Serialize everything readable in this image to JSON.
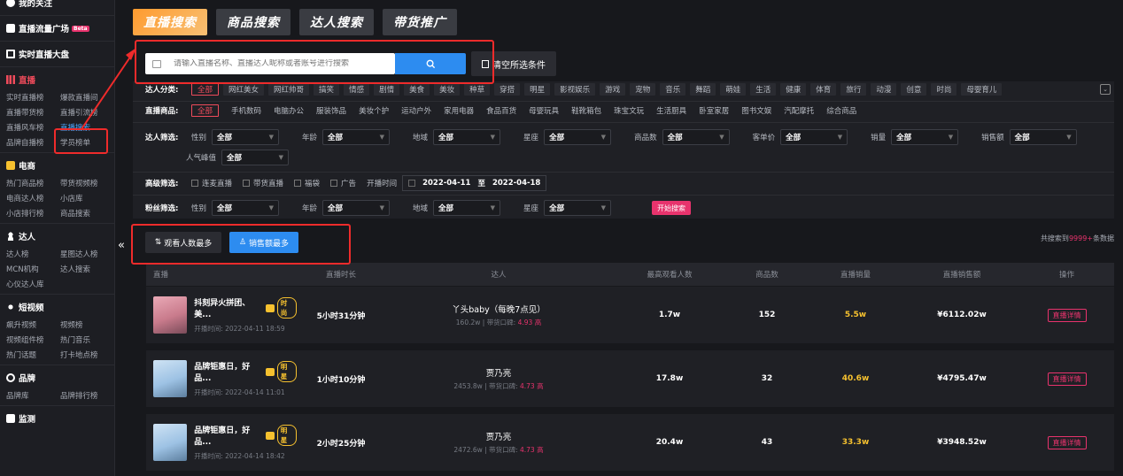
{
  "sidebar": {
    "top_item": "我的关注",
    "traffic": {
      "label": "直播流量广场",
      "badge": "Beta"
    },
    "realtime": "实时直播大盘",
    "live": {
      "title": "直播",
      "rows": [
        [
          "实时直播榜",
          "爆款直播间"
        ],
        [
          "直播带货榜",
          "直播引流榜"
        ],
        [
          "直播风车榜",
          "直播搜索"
        ],
        [
          "品牌自播榜",
          "学员榜单"
        ]
      ]
    },
    "ecom": {
      "title": "电商",
      "rows": [
        [
          "热门商品榜",
          "带货视频榜"
        ],
        [
          "电商达人榜",
          "小店库"
        ],
        [
          "小店排行榜",
          "商品搜索"
        ]
      ]
    },
    "kol": {
      "title": "达人",
      "rows": [
        [
          "达人榜",
          "星图达人榜"
        ],
        [
          "MCN机构",
          "达人搜索"
        ],
        [
          "心仪达人库",
          ""
        ]
      ]
    },
    "video": {
      "title": "短视频",
      "rows": [
        [
          "飙升视频",
          "视频榜"
        ],
        [
          "视频组件榜",
          "热门音乐"
        ],
        [
          "热门话题",
          "打卡地点榜"
        ]
      ]
    },
    "brand": {
      "title": "品牌",
      "rows": [
        [
          "品牌库",
          "品牌排行榜"
        ]
      ]
    },
    "monitor": {
      "title": "监测"
    }
  },
  "tabs": [
    "直播搜索",
    "商品搜索",
    "达人搜索",
    "带货推广"
  ],
  "search": {
    "placeholder": "请输入直播名称、直播达人昵称或者账号进行搜索",
    "clear": "清空所选条件"
  },
  "filters": {
    "kol_category": {
      "label": "达人分类:",
      "items": [
        "全部",
        "网红美女",
        "网红帅哥",
        "搞笑",
        "情感",
        "剧情",
        "美食",
        "美妆",
        "种草",
        "穿搭",
        "明星",
        "影视娱乐",
        "游戏",
        "宠物",
        "音乐",
        "舞蹈",
        "萌娃",
        "生活",
        "健康",
        "体育",
        "旅行",
        "动漫",
        "创意",
        "时尚",
        "母婴育儿"
      ]
    },
    "goods": {
      "label": "直播商品:",
      "items": [
        "全部",
        "手机数码",
        "电脑办公",
        "服装饰品",
        "美妆个护",
        "运动户外",
        "家用电器",
        "食品百货",
        "母婴玩具",
        "鞋靴箱包",
        "珠宝文玩",
        "生活厨具",
        "卧室家居",
        "图书文娱",
        "汽配摩托",
        "综合商品"
      ]
    },
    "kol_filter": {
      "label": "达人筛选:",
      "fields": [
        "性别",
        "年龄",
        "地域",
        "星座",
        "商品数",
        "客单价",
        "销量",
        "销售额"
      ],
      "popularity": "人气峰值"
    },
    "advanced": {
      "label": "高级筛选:",
      "checks": [
        "连麦直播",
        "带货直播",
        "福袋",
        "广告"
      ],
      "time_label": "开播时间",
      "from": "2022-04-11",
      "sep": "至",
      "to": "2022-04-18"
    },
    "fans": {
      "label": "粉丝筛选:",
      "fields": [
        "性别",
        "年龄",
        "地域",
        "星座"
      ],
      "start": "开始搜索"
    },
    "all": "全部"
  },
  "sort": {
    "viewers": "观看人数最多",
    "sales": "销售额最多",
    "total_prefix": "共搜索到",
    "total_value": "9999+",
    "total_suffix": "条数据"
  },
  "table": {
    "headers": [
      "直播",
      "直播时长",
      "达人",
      "最高观看人数",
      "商品数",
      "直播销量",
      "直播销售额",
      "操作"
    ],
    "rows": [
      {
        "title": "抖刻异火拼团、美...",
        "tag": "时尚",
        "start": "开播时间: 2022-04-11 18:59",
        "duration": "5小时31分钟",
        "name": "丫头baby（每晚7点见）",
        "fans": "160.2w",
        "score_label": "带货口碑:",
        "score": "4.93 高",
        "viewers": "1.7w",
        "goods": "152",
        "sales": "5.5w",
        "revenue": "¥6112.02w",
        "action": "直播详情"
      },
      {
        "title": "品牌钜惠日，好品...",
        "tag": "明星",
        "start": "开播时间: 2022-04-14 11:01",
        "duration": "1小时10分钟",
        "name": "贾乃亮",
        "fans": "2453.8w",
        "score_label": "带货口碑:",
        "score": "4.73 高",
        "viewers": "17.8w",
        "goods": "32",
        "sales": "40.6w",
        "revenue": "¥4795.47w",
        "action": "直播详情"
      },
      {
        "title": "品牌钜惠日，好品...",
        "tag": "明星",
        "start": "开播时间: 2022-04-14 18:42",
        "duration": "2小时25分钟",
        "name": "贾乃亮",
        "fans": "2472.6w",
        "score_label": "带货口碑:",
        "score": "4.73 高",
        "viewers": "20.4w",
        "goods": "43",
        "sales": "33.3w",
        "revenue": "¥3948.52w",
        "action": "直播详情"
      }
    ]
  }
}
